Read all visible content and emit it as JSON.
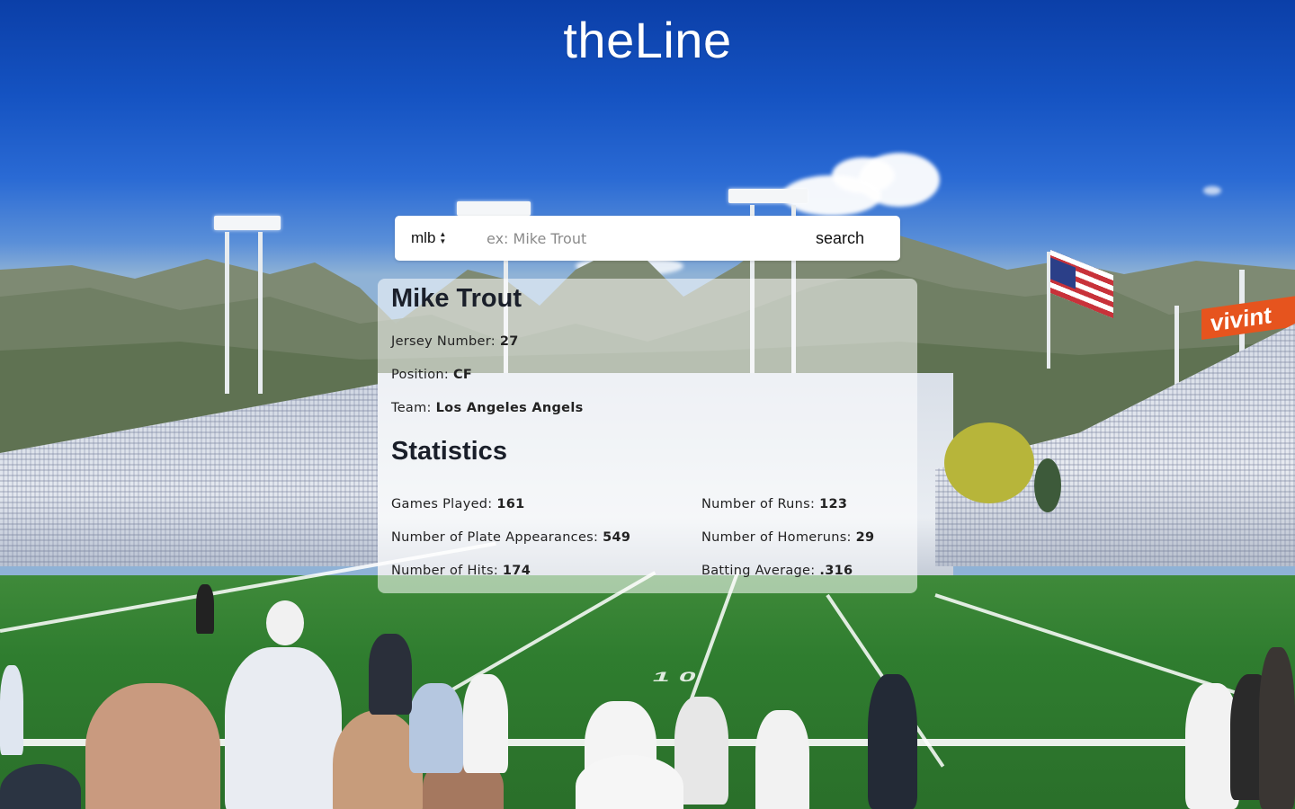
{
  "app": {
    "title": "theLine"
  },
  "search": {
    "league_value": "mlb",
    "placeholder": "ex: Mike Trout",
    "input_value": "",
    "button_label": "search"
  },
  "player": {
    "name": "Mike Trout",
    "details": [
      {
        "label": "Jersey Number:",
        "value": "27"
      },
      {
        "label": "Position:",
        "value": "CF"
      },
      {
        "label": "Team:",
        "value": "Los Angeles Angels"
      }
    ]
  },
  "statistics": {
    "heading": "Statistics",
    "left": [
      {
        "label": "Games Played:",
        "value": "161"
      },
      {
        "label": "Number of Plate Appearances:",
        "value": "549"
      },
      {
        "label": "Number of Hits:",
        "value": "174"
      }
    ],
    "right": [
      {
        "label": "Number of Runs:",
        "value": "123"
      },
      {
        "label": "Number of Homeruns:",
        "value": "29"
      },
      {
        "label": "Batting Average:",
        "value": ".316"
      }
    ]
  },
  "background": {
    "scene": "stadium-photo",
    "sign_text": "vivint",
    "yard_marker": "10"
  }
}
